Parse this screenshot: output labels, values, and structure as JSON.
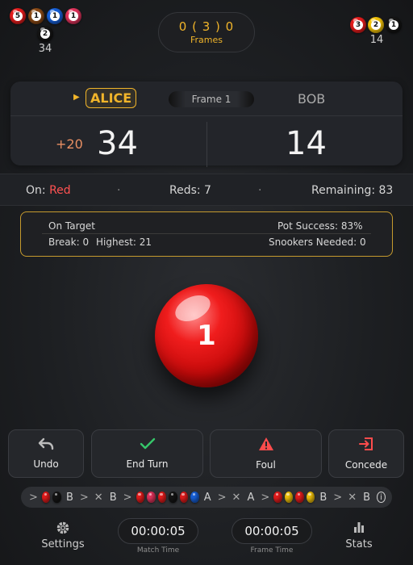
{
  "colors": {
    "accent": "#f0b42a",
    "red": "#e51c1c",
    "brown": "#8b4a16",
    "blue": "#1760d8",
    "pink": "#e0335c",
    "black": "#151515",
    "yellow": "#f2c20a"
  },
  "header": {
    "left_potted": [
      {
        "color": "red",
        "count": "5"
      },
      {
        "color": "brown",
        "count": "1"
      },
      {
        "color": "blue",
        "count": "1"
      },
      {
        "color": "pink",
        "count": "1"
      },
      {
        "color": "black",
        "count": "2"
      }
    ],
    "left_total": "34",
    "frames_score": "0 ( 3 ) 0",
    "frames_label": "Frames",
    "right_potted": [
      {
        "color": "red",
        "count": "3"
      },
      {
        "color": "yellow",
        "count": "2"
      },
      {
        "color": "black",
        "count": "1"
      }
    ],
    "right_total": "14"
  },
  "scoreboard": {
    "player_a": "ALICE",
    "player_b": "BOB",
    "frame_label": "Frame 1",
    "bonus_a": "+20",
    "score_a": "34",
    "score_b": "14"
  },
  "status": {
    "on_label": "On:",
    "on_value": "Red",
    "separator": "·",
    "reds": "Reds: 7",
    "remaining": "Remaining: 83"
  },
  "target": {
    "on_target": "On Target",
    "pot_success": "Pot Success: 83%",
    "break": "Break: 0",
    "highest": "Highest: 21",
    "snookers": "Snookers Needed: 0"
  },
  "ball_on": {
    "color": "red",
    "value": "1"
  },
  "actions": {
    "undo": "Undo",
    "end_turn": "End Turn",
    "foul": "Foul",
    "concede": "Concede"
  },
  "history": {
    "arrow": ">",
    "tokens": [
      {
        "balls": [
          "red",
          "black"
        ],
        "player": "B"
      },
      {
        "balls": [],
        "player": "B",
        "miss": true
      },
      {
        "balls": [
          "red",
          "pink",
          "red",
          "black",
          "red",
          "blue"
        ],
        "player": "A"
      },
      {
        "balls": [],
        "player": "A",
        "miss": true
      },
      {
        "balls": [
          "red",
          "yellow",
          "red",
          "yellow"
        ],
        "player": "B"
      },
      {
        "balls": [],
        "player": "B",
        "miss": true
      }
    ],
    "miss_glyph": "✕"
  },
  "footer": {
    "settings": "Settings",
    "match_time": "00:00:05",
    "match_time_label": "Match Time",
    "frame_time": "00:00:05",
    "frame_time_label": "Frame Time",
    "stats": "Stats"
  }
}
